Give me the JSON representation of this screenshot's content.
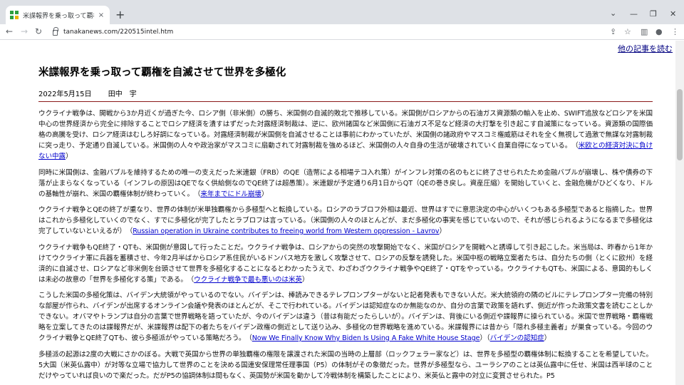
{
  "browser": {
    "tab_title": "米諜報界を乗っ取って覇権を自滅させ",
    "tab_close": "×",
    "newtab": "+",
    "url": "tanakanews.com/220515intel.htm",
    "controls": {
      "dropdown": "⌄",
      "minimize": "—",
      "maximize": "❐",
      "close": "✕"
    },
    "nav": {
      "back": "←",
      "forward": "→",
      "reload": "↻"
    },
    "icons": {
      "share": "⇪",
      "star": "☆",
      "sidepanel": "▥",
      "profile": "●",
      "menu": "⋮"
    }
  },
  "page": {
    "other_articles": "他の記事を読む",
    "headline": "米諜報界を乗っ取って覇権を自滅させて世界を多極化",
    "date": "2022年5月15日",
    "author": "田中　宇",
    "paragraphs": [
      {
        "text": "ウクライナ戦争は、開戦から3か月近くが過ぎた今、ロシア側（非米側）の勝ち、米国側の自滅的敗北で推移している。米国側がロシアからの石油ガス資源類の輸入を止め、SWIFT追放などロシアを米国中心の世界経済から完全に排除することでロシア経済を潰すはずだった対露経済制裁は、逆に、欧州諸国など米国側に石油ガス不足など経済の大打撃を引き起こす自滅策になっている。資源類の国際価格の高騰を受け、ロシア経済はむしろ好調になっている。対露経済制裁が米国側を自滅させることは事前にわかっていたが、米国側の諸政府やマスコミ権威筋はそれを全く無視して過激で無謀な対露制裁に突っ走り、予定通り自滅している。米国側の人々や政治家がマスコミに扇動されて対露制裁を強めるほど、米国側の人々自身の生活が破壊されていく自業自得になっている。　",
        "link": "米欧との経済対決に負けない中露",
        "open": "（",
        "close": "）"
      },
      {
        "text": "同時に米国側は、金融バブルを維持するための唯一の支えだった米連銀（FRB）のQE（造幣による相場テコ入れ策）がインフレ対策の名のもとに終了させられたため金融バブルが崩壊し、株や債券の下落が止まらなくなっている（インフレの原因はQEでなく供給側なのでQE終了は超愚策）。米連銀が予定通り6月1日からQT（QEの巻き戻し。資産圧縮）を開始していくと、金融危機がひどくなり、ドルの基軸性が崩れ、米国の覇権体制が終わっていく。　",
        "link": "来年までにドル崩壊",
        "open": "（",
        "close": "）"
      },
      {
        "text": "ウクライナ戦争とQEの終了が重なり、世界の体制が米単独覇権から多極型へと転換している。ロシアのラブロフ外相は最近、世界はすでに意思決定の中心がいくつもある多極型であると指摘した。世界はこれから多極化していくのでなく、すでに多極化が完了したとラブロフは言っている。（米国側の人々のほとんどが、まだ多極化の事実を感じていないので、それが感じられるようになるまで多極化は完了していないといえるが）　",
        "link": "Russian operation in Ukraine contributes to freeing world from Western oppression - Lavrov",
        "open": "（",
        "close": "）"
      },
      {
        "text": "ウクライナ戦争もQE終了・QTも、米国側が意図して行ったことだ。ウクライナ戦争は、ロシアからの突然の攻撃開始でなく、米国がロシアを開戦へと誘導して引き起こした。米当局は、昨春から1年かけてウクライナ軍に兵器を蓄積させ、今年2月半ばからロシア系住民がいるドンバス地方を激しく攻撃させて、ロシアの反撃を誘発した。米国中枢の戦略立案者たちは、自分たちの側（とくに欧州）を経済的に自滅させ、ロシアなど非米側を台頭させて世界を多極化することになるとわかったうえで、わざわざウクライナ戦争やQE終了・QTをやっている。ウクライナもQTも、米国による、意図的もしくは未必の故意の「世界を多極化する策」である。　",
        "link": "ウクライナ戦争で最も悪いのは米英",
        "open": "（",
        "close": "）"
      },
      {
        "text": "こうした米国の多極化策は、バイデン大統領がやっているのでない。バイデンは、棒読みできるテレプロンプターがないと記者発表もできない人だ。米大統領府の隣のビルにテレプロンプター完備の特別な部屋が作られ、バイデンが出席するオンライン会議や発表のほとんどが、そこで行われている。バイデンは認知症なのか無能なのか、自分の言葉で政策を語れず、側近が作った政策文書を読むことしかできない。オバマやトランプは自分の言葉で世界戦略を語っていたが、今のバイデンは違う（昔は有能だったらしいが）。バイデンは、背後にいる側近や諜報界に操られている。米国で世界戦略・覇権戦略を立案してきたのは諜報界だが、米諜報界は配下の者たちをバイデン政権の側近として送り込み、多極化の世界戦略を進めている。米諜報界には昔から「隠れ多極主義者」が巣食っている。今回のウクライナ戦争とQE終了QTも、彼ら多極派がやっている策略だろう。　",
        "link": "Now We Finally Know Why Biden Is Using A Fake White House Stage",
        "open": "（",
        "close": "）",
        "link2": "バイデンの認知症",
        "open2": "（",
        "close2": "）"
      },
      {
        "text": "多極派の起源は2度の大戦にさかのぼる。大戦で英国から世界の単独覇権の権限を譲渡された米国の当時の上層部（ロックフェラー家など）は、世界を多極型の覇権体制に転換することを希望していた。5大国（米英仏露中）が対等な立場で協力して世界のことを決める国連安保理常任理事国（P5）の体制がその象徴だった。世界が多極型なら、ユーラシアのことは英仏露中に任せ、米国は西半球のことだけやっていれば良いので楽だった。だがP5の協調体制は間もなく、英国勢が米国を動かして冷戦体制を構築したことにより、米英仏と露中の対立に変質させられた。P5"
      }
    ]
  }
}
